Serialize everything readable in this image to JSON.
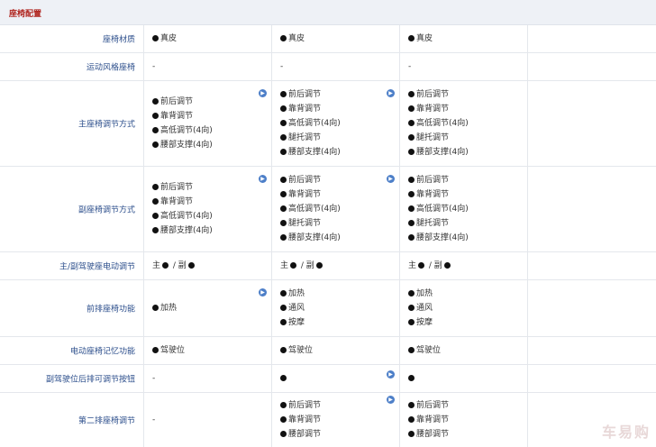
{
  "section_title": "座椅配置",
  "rows": {
    "material": {
      "label": "座椅材质",
      "c1": "真皮",
      "c2": "真皮",
      "c3": "真皮"
    },
    "sport": {
      "label": "运动风格座椅",
      "c1": "-",
      "c2": "-",
      "c3": "-"
    },
    "driver": {
      "label": "主座椅调节方式",
      "c1": [
        "前后调节",
        "靠背调节",
        "高低调节(4向)",
        "腰部支撑(4向)"
      ],
      "c2": [
        "前后调节",
        "靠背调节",
        "高低调节(4向)",
        "腿托调节",
        "腰部支撑(4向)"
      ],
      "c3": [
        "前后调节",
        "靠背调节",
        "高低调节(4向)",
        "腿托调节",
        "腰部支撑(4向)"
      ]
    },
    "passenger": {
      "label": "副座椅调节方式",
      "c1": [
        "前后调节",
        "靠背调节",
        "高低调节(4向)",
        "腰部支撑(4向)"
      ],
      "c2": [
        "前后调节",
        "靠背调节",
        "高低调节(4向)",
        "腿托调节",
        "腰部支撑(4向)"
      ],
      "c3": [
        "前后调节",
        "靠背调节",
        "高低调节(4向)",
        "腿托调节",
        "腰部支撑(4向)"
      ]
    },
    "electric": {
      "label": "主/副驾驶座电动调节",
      "main": "主",
      "sep": " / ",
      "sub": "副"
    },
    "front_func": {
      "label": "前排座椅功能",
      "c1": [
        "加热"
      ],
      "c2": [
        "加热",
        "通风",
        "按摩"
      ],
      "c3": [
        "加热",
        "通风",
        "按摩"
      ]
    },
    "memory": {
      "label": "电动座椅记忆功能",
      "c1": "驾驶位",
      "c2": "驾驶位",
      "c3": "驾驶位"
    },
    "rear_button": {
      "label": "副驾驶位后排可调节按钮",
      "c1": "-"
    },
    "second_row": {
      "label": "第二排座椅调节",
      "c1": "-",
      "c2": [
        "前后调节",
        "靠背调节",
        "腰部调节"
      ],
      "c3": [
        "前后调节",
        "靠背调节",
        "腰部调节"
      ]
    }
  },
  "icons": {
    "expand": "play-circle-icon",
    "bullet": "filled-dot-icon"
  },
  "colors": {
    "title": "#b0251f",
    "label": "#2d4f8c",
    "header_bg": "#eef1f6",
    "icon": "#4d7fc8"
  },
  "watermark": "车易购"
}
